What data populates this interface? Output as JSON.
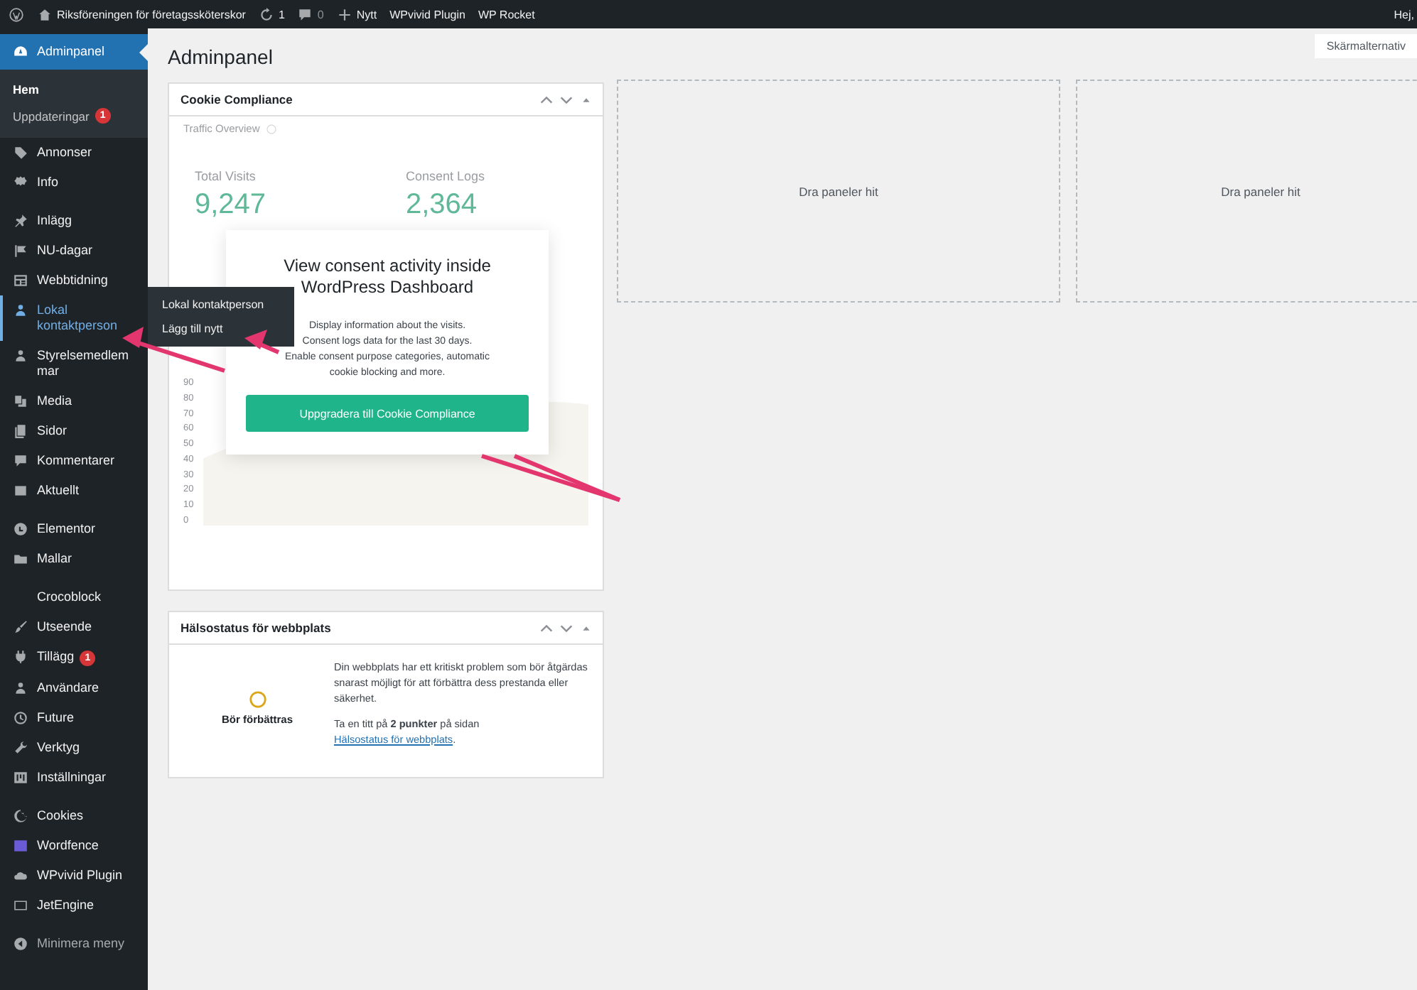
{
  "admin_bar": {
    "site_name": "Riksföreningen för företagssköterskor",
    "updates_count": "1",
    "comments_count": "0",
    "new_label": "Nytt",
    "items": [
      "WPvivid Plugin",
      "WP Rocket"
    ],
    "greeting": "Hej,"
  },
  "sidebar": {
    "groups": [
      {
        "items": [
          {
            "label": "Adminpanel",
            "selected": true,
            "hovered": false,
            "submenu": [
              {
                "label": "Hem",
                "selected": true
              },
              {
                "label": "Uppdateringar",
                "selected": false,
                "badge": "1"
              }
            ]
          },
          {
            "label": "Annonser",
            "selected": false,
            "hovered": false
          },
          {
            "label": "Info",
            "selected": false,
            "hovered": false
          }
        ]
      },
      {
        "items": [
          {
            "label": "Inlägg",
            "selected": false,
            "hovered": false
          },
          {
            "label": "NU-dagar",
            "selected": false,
            "hovered": false
          },
          {
            "label": "Webbtidning",
            "selected": false,
            "hovered": false
          },
          {
            "label": "Lokal kontaktperson",
            "selected": false,
            "hovered": true,
            "flyout": [
              "Lokal kontaktperson",
              "Lägg till nytt"
            ]
          },
          {
            "label": "Styrelsemedlemmar",
            "selected": false,
            "hovered": false
          },
          {
            "label": "Media",
            "selected": false,
            "hovered": false
          },
          {
            "label": "Sidor",
            "selected": false,
            "hovered": false
          },
          {
            "label": "Kommentarer",
            "selected": false,
            "hovered": false
          },
          {
            "label": "Aktuellt",
            "selected": false,
            "hovered": false
          }
        ]
      },
      {
        "items": [
          {
            "label": "Elementor",
            "selected": false,
            "hovered": false
          },
          {
            "label": "Mallar",
            "selected": false,
            "hovered": false
          }
        ]
      },
      {
        "items": [
          {
            "label": "Crocoblock",
            "selected": false,
            "hovered": false
          },
          {
            "label": "Utseende",
            "selected": false,
            "hovered": false
          },
          {
            "label": "Tillägg",
            "selected": false,
            "hovered": false,
            "badge": "1"
          },
          {
            "label": "Användare",
            "selected": false,
            "hovered": false
          },
          {
            "label": "Future",
            "selected": false,
            "hovered": false
          },
          {
            "label": "Verktyg",
            "selected": false,
            "hovered": false
          },
          {
            "label": "Inställningar",
            "selected": false,
            "hovered": false
          }
        ]
      },
      {
        "items": [
          {
            "label": "Cookies",
            "selected": false,
            "hovered": false
          },
          {
            "label": "Wordfence",
            "selected": false,
            "hovered": false
          },
          {
            "label": "WPvivid Plugin",
            "selected": false,
            "hovered": false
          },
          {
            "label": "JetEngine",
            "selected": false,
            "hovered": false
          }
        ]
      }
    ],
    "collapse_label": "Minimera meny"
  },
  "page_title": "Adminpanel",
  "screen_options": "Skärmalternativ",
  "cookie_widget": {
    "title": "Cookie Compliance",
    "section": "Traffic Overview",
    "stats": [
      {
        "label": "Total Visits",
        "value": "9,247"
      },
      {
        "label": "Consent Logs",
        "value": "2,364"
      }
    ],
    "y_axis_labels": [
      "90",
      "80",
      "70",
      "60",
      "50",
      "40",
      "30",
      "20",
      "10",
      "0"
    ],
    "promo": {
      "title": "View consent activity inside WordPress Dashboard",
      "lines": [
        "Display information about the visits.",
        "Consent logs data for the last 30 days.",
        "Enable consent purpose categories, automatic cookie blocking and more."
      ],
      "button": "Uppgradera till Cookie Compliance"
    }
  },
  "health_widget": {
    "title": "Hälsostatus för webbplats",
    "status": "Bör förbättras",
    "message": "Din webbplats har ett kritiskt problem som bör åtgärdas snarast möjligt för att förbättra dess prestanda eller säkerhet.",
    "hint_before": "Ta en titt på **2 punkter** på sidan",
    "hint_link": "Hälsostatus för webbplats",
    "hint_after": "."
  },
  "drop_zones": [
    "Dra paneler hit",
    "Dra paneler hit"
  ]
}
